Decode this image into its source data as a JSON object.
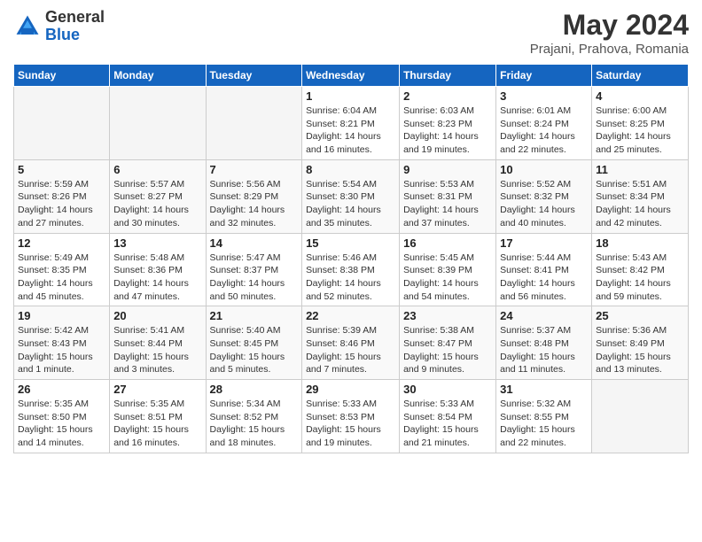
{
  "header": {
    "logo_general": "General",
    "logo_blue": "Blue",
    "month_year": "May 2024",
    "location": "Prajani, Prahova, Romania"
  },
  "weekdays": [
    "Sunday",
    "Monday",
    "Tuesday",
    "Wednesday",
    "Thursday",
    "Friday",
    "Saturday"
  ],
  "weeks": [
    [
      {
        "day": "",
        "info": ""
      },
      {
        "day": "",
        "info": ""
      },
      {
        "day": "",
        "info": ""
      },
      {
        "day": "1",
        "info": "Sunrise: 6:04 AM\nSunset: 8:21 PM\nDaylight: 14 hours\nand 16 minutes."
      },
      {
        "day": "2",
        "info": "Sunrise: 6:03 AM\nSunset: 8:23 PM\nDaylight: 14 hours\nand 19 minutes."
      },
      {
        "day": "3",
        "info": "Sunrise: 6:01 AM\nSunset: 8:24 PM\nDaylight: 14 hours\nand 22 minutes."
      },
      {
        "day": "4",
        "info": "Sunrise: 6:00 AM\nSunset: 8:25 PM\nDaylight: 14 hours\nand 25 minutes."
      }
    ],
    [
      {
        "day": "5",
        "info": "Sunrise: 5:59 AM\nSunset: 8:26 PM\nDaylight: 14 hours\nand 27 minutes."
      },
      {
        "day": "6",
        "info": "Sunrise: 5:57 AM\nSunset: 8:27 PM\nDaylight: 14 hours\nand 30 minutes."
      },
      {
        "day": "7",
        "info": "Sunrise: 5:56 AM\nSunset: 8:29 PM\nDaylight: 14 hours\nand 32 minutes."
      },
      {
        "day": "8",
        "info": "Sunrise: 5:54 AM\nSunset: 8:30 PM\nDaylight: 14 hours\nand 35 minutes."
      },
      {
        "day": "9",
        "info": "Sunrise: 5:53 AM\nSunset: 8:31 PM\nDaylight: 14 hours\nand 37 minutes."
      },
      {
        "day": "10",
        "info": "Sunrise: 5:52 AM\nSunset: 8:32 PM\nDaylight: 14 hours\nand 40 minutes."
      },
      {
        "day": "11",
        "info": "Sunrise: 5:51 AM\nSunset: 8:34 PM\nDaylight: 14 hours\nand 42 minutes."
      }
    ],
    [
      {
        "day": "12",
        "info": "Sunrise: 5:49 AM\nSunset: 8:35 PM\nDaylight: 14 hours\nand 45 minutes."
      },
      {
        "day": "13",
        "info": "Sunrise: 5:48 AM\nSunset: 8:36 PM\nDaylight: 14 hours\nand 47 minutes."
      },
      {
        "day": "14",
        "info": "Sunrise: 5:47 AM\nSunset: 8:37 PM\nDaylight: 14 hours\nand 50 minutes."
      },
      {
        "day": "15",
        "info": "Sunrise: 5:46 AM\nSunset: 8:38 PM\nDaylight: 14 hours\nand 52 minutes."
      },
      {
        "day": "16",
        "info": "Sunrise: 5:45 AM\nSunset: 8:39 PM\nDaylight: 14 hours\nand 54 minutes."
      },
      {
        "day": "17",
        "info": "Sunrise: 5:44 AM\nSunset: 8:41 PM\nDaylight: 14 hours\nand 56 minutes."
      },
      {
        "day": "18",
        "info": "Sunrise: 5:43 AM\nSunset: 8:42 PM\nDaylight: 14 hours\nand 59 minutes."
      }
    ],
    [
      {
        "day": "19",
        "info": "Sunrise: 5:42 AM\nSunset: 8:43 PM\nDaylight: 15 hours\nand 1 minute."
      },
      {
        "day": "20",
        "info": "Sunrise: 5:41 AM\nSunset: 8:44 PM\nDaylight: 15 hours\nand 3 minutes."
      },
      {
        "day": "21",
        "info": "Sunrise: 5:40 AM\nSunset: 8:45 PM\nDaylight: 15 hours\nand 5 minutes."
      },
      {
        "day": "22",
        "info": "Sunrise: 5:39 AM\nSunset: 8:46 PM\nDaylight: 15 hours\nand 7 minutes."
      },
      {
        "day": "23",
        "info": "Sunrise: 5:38 AM\nSunset: 8:47 PM\nDaylight: 15 hours\nand 9 minutes."
      },
      {
        "day": "24",
        "info": "Sunrise: 5:37 AM\nSunset: 8:48 PM\nDaylight: 15 hours\nand 11 minutes."
      },
      {
        "day": "25",
        "info": "Sunrise: 5:36 AM\nSunset: 8:49 PM\nDaylight: 15 hours\nand 13 minutes."
      }
    ],
    [
      {
        "day": "26",
        "info": "Sunrise: 5:35 AM\nSunset: 8:50 PM\nDaylight: 15 hours\nand 14 minutes."
      },
      {
        "day": "27",
        "info": "Sunrise: 5:35 AM\nSunset: 8:51 PM\nDaylight: 15 hours\nand 16 minutes."
      },
      {
        "day": "28",
        "info": "Sunrise: 5:34 AM\nSunset: 8:52 PM\nDaylight: 15 hours\nand 18 minutes."
      },
      {
        "day": "29",
        "info": "Sunrise: 5:33 AM\nSunset: 8:53 PM\nDaylight: 15 hours\nand 19 minutes."
      },
      {
        "day": "30",
        "info": "Sunrise: 5:33 AM\nSunset: 8:54 PM\nDaylight: 15 hours\nand 21 minutes."
      },
      {
        "day": "31",
        "info": "Sunrise: 5:32 AM\nSunset: 8:55 PM\nDaylight: 15 hours\nand 22 minutes."
      },
      {
        "day": "",
        "info": ""
      }
    ]
  ]
}
